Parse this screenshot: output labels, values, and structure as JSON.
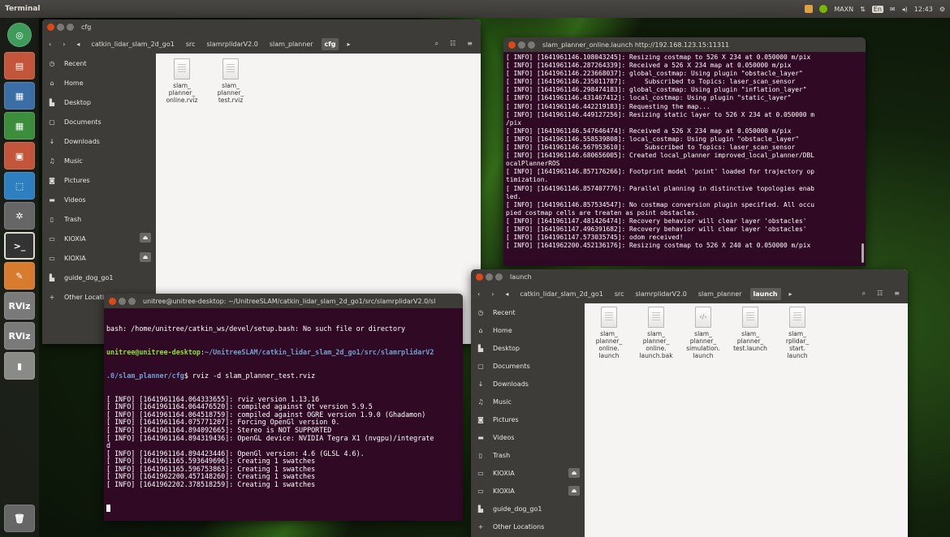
{
  "top_panel": {
    "app_name": "Terminal",
    "tray_label": "MAXN",
    "lang": "En",
    "time": "12:43"
  },
  "launcher": {
    "rviz_label": "RViz"
  },
  "fm1": {
    "title": "cfg",
    "breadcrumbs": [
      "catkin_lidar_slam_2d_go1",
      "src",
      "slamrplidarV2.0",
      "slam_planner",
      "cfg"
    ],
    "sidebar": [
      "Recent",
      "Home",
      "Desktop",
      "Documents",
      "Downloads",
      "Music",
      "Pictures",
      "Videos",
      "Trash",
      "KIOXIA",
      "KIOXIA",
      "guide_dog_go1",
      "Other Locations"
    ],
    "files": [
      {
        "line1": "slam_",
        "line2": "planner_",
        "line3": "online.rviz"
      },
      {
        "line1": "slam_",
        "line2": "planner_",
        "line3": "test.rviz"
      }
    ]
  },
  "term1": {
    "title": "unitree@unitree-desktop: ~/UnitreeSLAM/catkin_lidar_slam_2d_go1/src/slamrplidarV2.0/sl",
    "line0": "bash: /home/unitree/catkin_ws/devel/setup.bash: No such file or directory",
    "prompt_user": "unitree@unitree-desktop",
    "prompt_path1": "~/UnitreeSLAM/catkin_lidar_slam_2d_go1/src/slamrplidarV2",
    "prompt_path2": ".0/slam_planner/cfg",
    "command": "$ rviz -d slam_planner_test.rviz",
    "lines": [
      "[ INFO] [1641961164.064333655]: rviz version 1.13.16",
      "[ INFO] [1641961164.064476520]: compiled against Qt version 5.9.5",
      "[ INFO] [1641961164.064518759]: compiled against OGRE version 1.9.0 (Ghadamon)",
      "[ INFO] [1641961164.075771207]: Forcing OpenGl version 0.",
      "[ INFO] [1641961164.894092665]: Stereo is NOT SUPPORTED",
      "[ INFO] [1641961164.894319436]: OpenGL device: NVIDIA Tegra X1 (nvgpu)/integrate",
      "d",
      "[ INFO] [1641961164.894423446]: OpenGl version: 4.6 (GLSL 4.6).",
      "[ INFO] [1641961165.593649696]: Creating 1 swatches",
      "[ INFO] [1641961165.596753863]: Creating 1 swatches",
      "[ INFO] [1641962200.457148260]: Creating 1 swatches",
      "[ INFO] [1641962202.378518259]: Creating 1 swatches"
    ]
  },
  "term2": {
    "title": "slam_planner_online.launch http://192.168.123.15:11311",
    "lines": [
      "[ INFO] [1641961146.108043245]: Resizing costmap to 526 X 234 at 0.050000 m/pix",
      "[ INFO] [1641961146.287264339]: Received a 526 X 234 map at 0.050000 m/pix",
      "[ INFO] [1641961146.223668037]: global_costmap: Using plugin \"obstacle_layer\"",
      "[ INFO] [1641961146.235011787]:     Subscribed to Topics: laser_scan_sensor",
      "[ INFO] [1641961146.298474183]: global_costmap: Using plugin \"inflation_layer\"",
      "[ INFO] [1641961146.431467412]: local_costmap: Using plugin \"static_layer\"",
      "[ INFO] [1641961146.442219183]: Requesting the map...",
      "[ INFO] [1641961146.449127256]: Resizing static layer to 526 X 234 at 0.050000 m",
      "/pix",
      "[ INFO] [1641961146.547646474]: Received a 526 X 234 map at 0.050000 m/pix",
      "[ INFO] [1641961146.558539808]: local_costmap: Using plugin \"obstacle_layer\"",
      "[ INFO] [1641961146.567953610]:     Subscribed to Topics: laser_scan_sensor",
      "[ INFO] [1641961146.680656005]: Created local_planner improved_local_planner/DBL",
      "ocalPlannerROS",
      "[ INFO] [1641961146.857176266]: Footprint model 'point' loaded for trajectory op",
      "timization.",
      "[ INFO] [1641961146.857407776]: Parallel planning in distinctive topologies enab",
      "led.",
      "[ INFO] [1641961146.857534547]: No costmap conversion plugin specified. All occu",
      "pied costmap cells are treaten as point obstacles.",
      "[ INFO] [1641961147.481426474]: Recovery behavior will clear layer 'obstacles'",
      "[ INFO] [1641961147.496391682]: Recovery behavior will clear layer 'obstacles'",
      "[ INFO] [1641961147.573035745]: odom received!",
      "[ INFO] [1641962200.452136176]: Resizing costmap to 526 X 240 at 0.050000 m/pix"
    ]
  },
  "fm2": {
    "title": "launch",
    "breadcrumbs": [
      "catkin_lidar_slam_2d_go1",
      "src",
      "slamrplidarV2.0",
      "slam_planner",
      "launch"
    ],
    "sidebar": [
      "Recent",
      "Home",
      "Desktop",
      "Documents",
      "Downloads",
      "Music",
      "Pictures",
      "Videos",
      "Trash",
      "KIOXIA",
      "KIOXIA",
      "guide_dog_go1",
      "Other Locations"
    ],
    "files": [
      {
        "line1": "slam_",
        "line2": "planner_",
        "line3": "online.",
        "line4": "launch",
        "type": "doc"
      },
      {
        "line1": "slam_",
        "line2": "planner_",
        "line3": "online.",
        "line4": "launch.bak",
        "type": "doc"
      },
      {
        "line1": "slam_",
        "line2": "planner_",
        "line3": "simulation.",
        "line4": "launch",
        "type": "code"
      },
      {
        "line1": "slam_",
        "line2": "planner_",
        "line3": "test.launch",
        "line4": "",
        "type": "doc"
      },
      {
        "line1": "slam_",
        "line2": "rplidar_",
        "line3": "start.",
        "line4": "launch",
        "type": "doc"
      }
    ]
  },
  "colors": {
    "terminal_bg": "#300a24",
    "ubuntu_orange": "#dd4814",
    "prompt_green": "#8ae234",
    "prompt_blue": "#729fcf"
  }
}
